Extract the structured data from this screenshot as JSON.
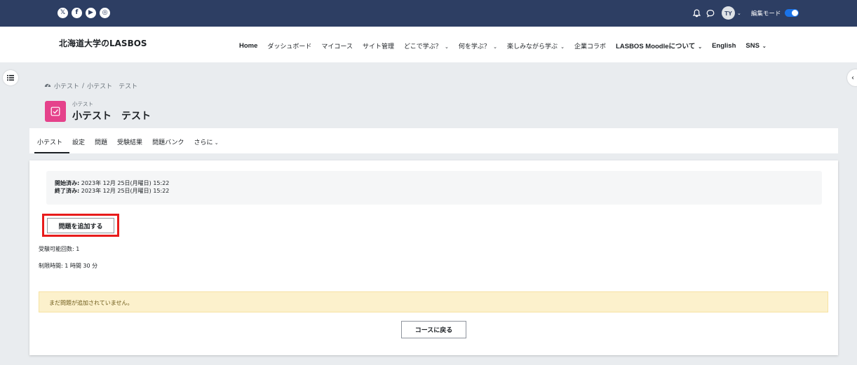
{
  "topbar": {
    "social": [
      {
        "icon": "x-icon",
        "glyph": "𝕏"
      },
      {
        "icon": "facebook-icon",
        "glyph": "f"
      },
      {
        "icon": "youtube-icon",
        "glyph": "▶"
      },
      {
        "icon": "instagram-icon",
        "glyph": "◎"
      }
    ],
    "avatar_initials": "TY",
    "edit_mode_label": "編集モード"
  },
  "navbar": {
    "brand": "北海道大学のLASBOS",
    "items": [
      {
        "label": "Home",
        "dropdown": false
      },
      {
        "label": "ダッシュボード",
        "dropdown": false
      },
      {
        "label": "マイコース",
        "dropdown": false
      },
      {
        "label": "サイト管理",
        "dropdown": false
      },
      {
        "label": "どこで学ぶ？",
        "dropdown": true
      },
      {
        "label": "何を学ぶ？",
        "dropdown": true
      },
      {
        "label": "楽しみながら学ぶ",
        "dropdown": true
      },
      {
        "label": "企業コラボ",
        "dropdown": false
      },
      {
        "label": "LASBOS Moodleについて",
        "dropdown": true
      },
      {
        "label": "English",
        "dropdown": false
      },
      {
        "label": "SNS",
        "dropdown": true
      }
    ]
  },
  "breadcrumb": {
    "items": [
      "小テスト",
      "小テスト　テスト"
    ],
    "separator": "/"
  },
  "header": {
    "activity_type": "小テスト",
    "title": "小テスト　テスト"
  },
  "secondary_nav": {
    "tabs": [
      {
        "label": "小テスト",
        "active": true
      },
      {
        "label": "設定",
        "active": false
      },
      {
        "label": "問題",
        "active": false
      },
      {
        "label": "受験結果",
        "active": false
      },
      {
        "label": "問題バンク",
        "active": false
      },
      {
        "label": "さらに",
        "active": false,
        "dropdown": true
      }
    ]
  },
  "content": {
    "opened_label": "開始済み:",
    "opened_value": "2023年 12月 25日(月曜日) 15:22",
    "closed_label": "終了済み:",
    "closed_value": "2023年 12月 25日(月曜日) 15:22",
    "add_question_button": "問題を追加する",
    "attempts_allowed": "受験可能回数: 1",
    "time_limit": "制限時間: 1 時間 30 分",
    "alert_text": "まだ問題が追加されていません。",
    "back_button": "コースに戻る"
  },
  "colors": {
    "topbar": "#2d3e63",
    "quiz_icon": "#e5428b",
    "highlight_frame": "#e81c1c",
    "toggle_on": "#1a73e8",
    "alert_bg": "#fcf1cc"
  }
}
